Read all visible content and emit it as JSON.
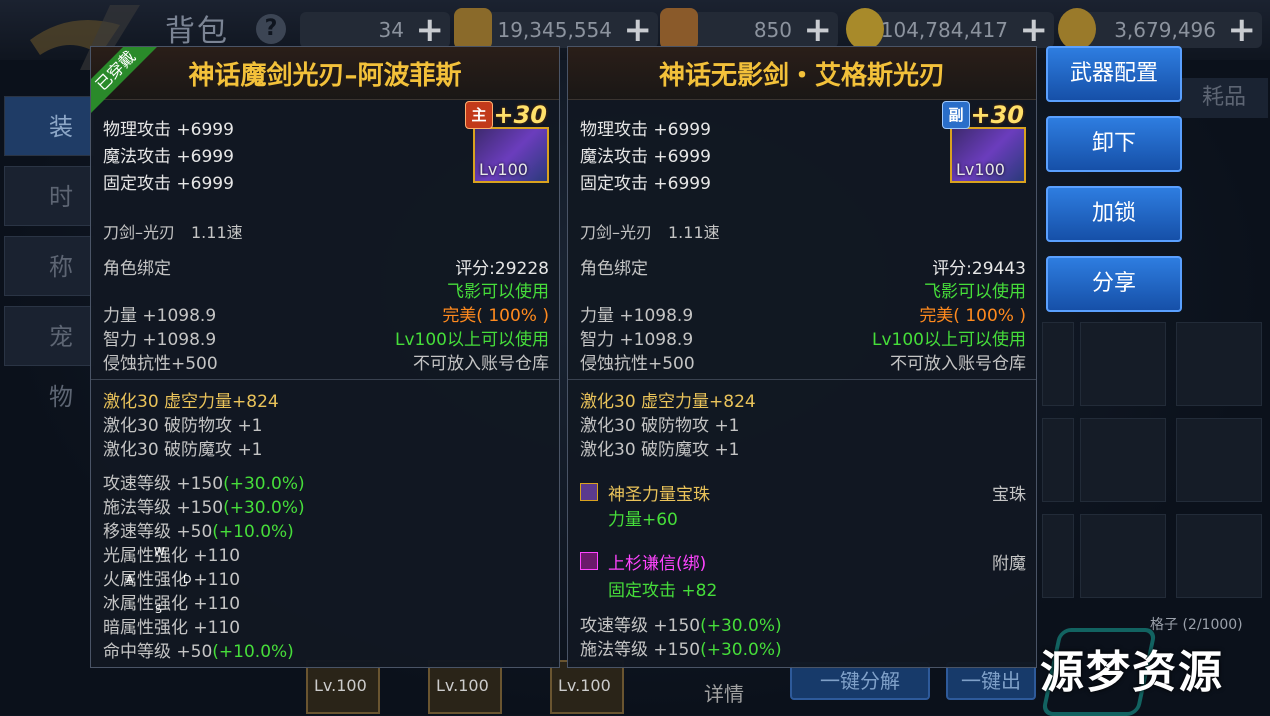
{
  "header": {
    "title": "背包",
    "resources": [
      "34",
      "19,345,554",
      "850",
      "104,784,417",
      "3,679,496"
    ]
  },
  "left_tabs": [
    "装备",
    "时装",
    "称号",
    "宠物"
  ],
  "right_tab": "耗品",
  "panel_left": {
    "worn_label": "已穿戴",
    "name": "神话魔剑光刃–阿波菲斯",
    "tag": "主",
    "enhance": "+30",
    "level": "Lv100",
    "stats": [
      "物理攻击 +6999",
      "魔法攻击 +6999",
      "固定攻击 +6999"
    ],
    "type": "刀剑–光刃　1.11速",
    "bind": "角色绑定",
    "score": "评分:29228",
    "flag1": "飞影可以使用",
    "quality": "完美( 100% )",
    "str": "力量 +1098.9",
    "int": "智力 +1098.9",
    "level_req": "Lv100以上可以使用",
    "resist": "侵蚀抗性+500",
    "no_store": "不可放入账号仓库",
    "enh1": "激化30 虚空力量+824",
    "enh2": "激化30 破防物攻 +1",
    "enh3": "激化30 破防魔攻 +1",
    "atk_speed": "攻速等级 +150",
    "atk_speed_pct": "(+30.0%)",
    "cast_speed": "施法等级 +150",
    "cast_speed_pct": "(+30.0%)",
    "move_speed": "移速等级 +50",
    "move_speed_pct": "(+10.0%)",
    "light": "光属性强化 +110",
    "fire": "火属性强化 +110",
    "ice": "冰属性强化 +110",
    "dark": "暗属性强化 +110",
    "hit": "命中等级 +50",
    "hit_pct": "(+10.0%)"
  },
  "panel_right": {
    "name": "神话无影剑・艾格斯光刃",
    "tag": "副",
    "enhance": "+30",
    "level": "Lv100",
    "stats": [
      "物理攻击 +6999",
      "魔法攻击 +6999",
      "固定攻击 +6999"
    ],
    "type": "刀剑–光刃　1.11速",
    "bind": "角色绑定",
    "score": "评分:29443",
    "flag1": "飞影可以使用",
    "quality": "完美( 100% )",
    "str": "力量 +1098.9",
    "int": "智力 +1098.9",
    "level_req": "Lv100以上可以使用",
    "resist": "侵蚀抗性+500",
    "no_store": "不可放入账号仓库",
    "enh1": "激化30 虚空力量+824",
    "enh2": "激化30 破防物攻 +1",
    "enh3": "激化30 破防魔攻 +1",
    "gem_name": "神圣力量宝珠",
    "gem_type": "宝珠",
    "gem_stat": "力量+60",
    "ench_name": "上杉谦信(绑)",
    "ench_type": "附魔",
    "ench_stat": "固定攻击 +82",
    "atk_speed": "攻速等级 +150",
    "atk_speed_pct": "(+30.0%)",
    "cast_speed": "施法等级 +150",
    "cast_speed_pct": "(+30.0%)"
  },
  "buttons": {
    "weapon_config": "武器配置",
    "unequip": "卸下",
    "lock": "加锁",
    "share": "分享"
  },
  "bottom": {
    "slot_lv": "Lv.100",
    "detail": "详情",
    "decompose": "一键分解",
    "other_btn": "一键出",
    "grid_count": "格子 (2/1000)"
  },
  "overlay": {
    "w": "W",
    "a": "A",
    "d": "D",
    "s": "S"
  },
  "watermark": "源梦资源"
}
